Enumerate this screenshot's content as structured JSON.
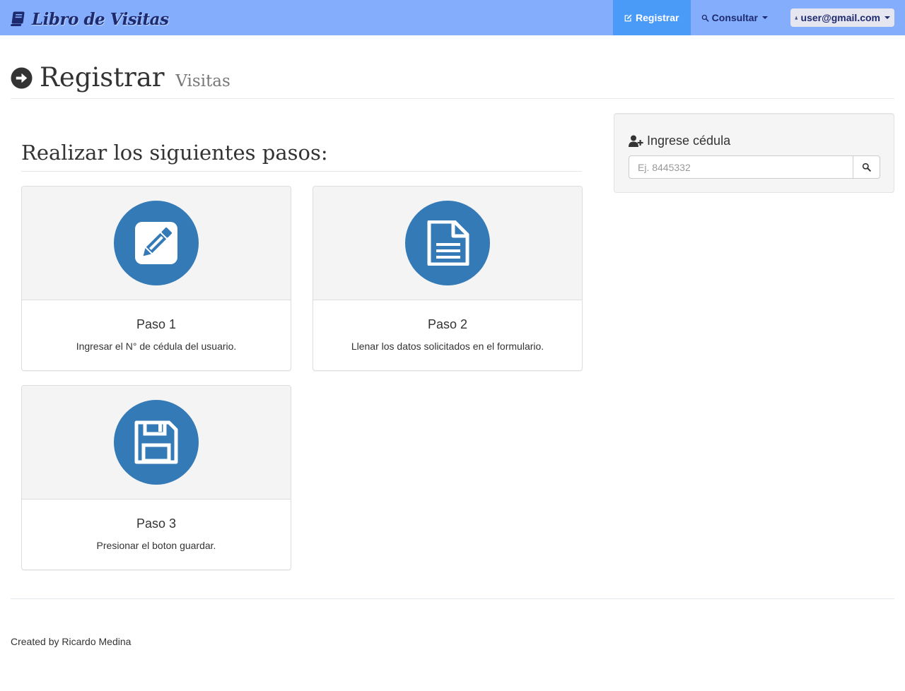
{
  "navbar": {
    "brand": "Libro de Visitas",
    "brand_icon": "book-icon",
    "registrar_label": "Registrar",
    "registrar_icon": "edit-icon",
    "consultar_label": "Consultar",
    "consultar_icon": "search-icon",
    "user_label": "user@gmail.com",
    "user_icon": "user-icon",
    "colors": {
      "bar": "#84aefc",
      "active": "#4a9bf7",
      "text": "#1e2a6e"
    }
  },
  "page_header": {
    "icon": "arrow-circle-right-icon",
    "title": "Registrar",
    "subtitle": "Visitas"
  },
  "steps": {
    "heading": "Realizar los siguientes pasos:",
    "accent_color": "#337ab7",
    "items": [
      {
        "title": "Paso 1",
        "text": "Ingresar el N° de cédula del usuario.",
        "icon": "pencil-square-icon"
      },
      {
        "title": "Paso 2",
        "text": "Llenar los datos solicitados en el formulario.",
        "icon": "file-text-icon"
      },
      {
        "title": "Paso 3",
        "text": "Presionar el boton guardar.",
        "icon": "floppy-disk-icon"
      }
    ]
  },
  "search_panel": {
    "label": "Ingrese cédula",
    "label_icon": "user-plus-icon",
    "placeholder": "Ej. 8445332",
    "button_icon": "search-icon"
  },
  "footer": {
    "text": "Created by Ricardo Medina"
  }
}
